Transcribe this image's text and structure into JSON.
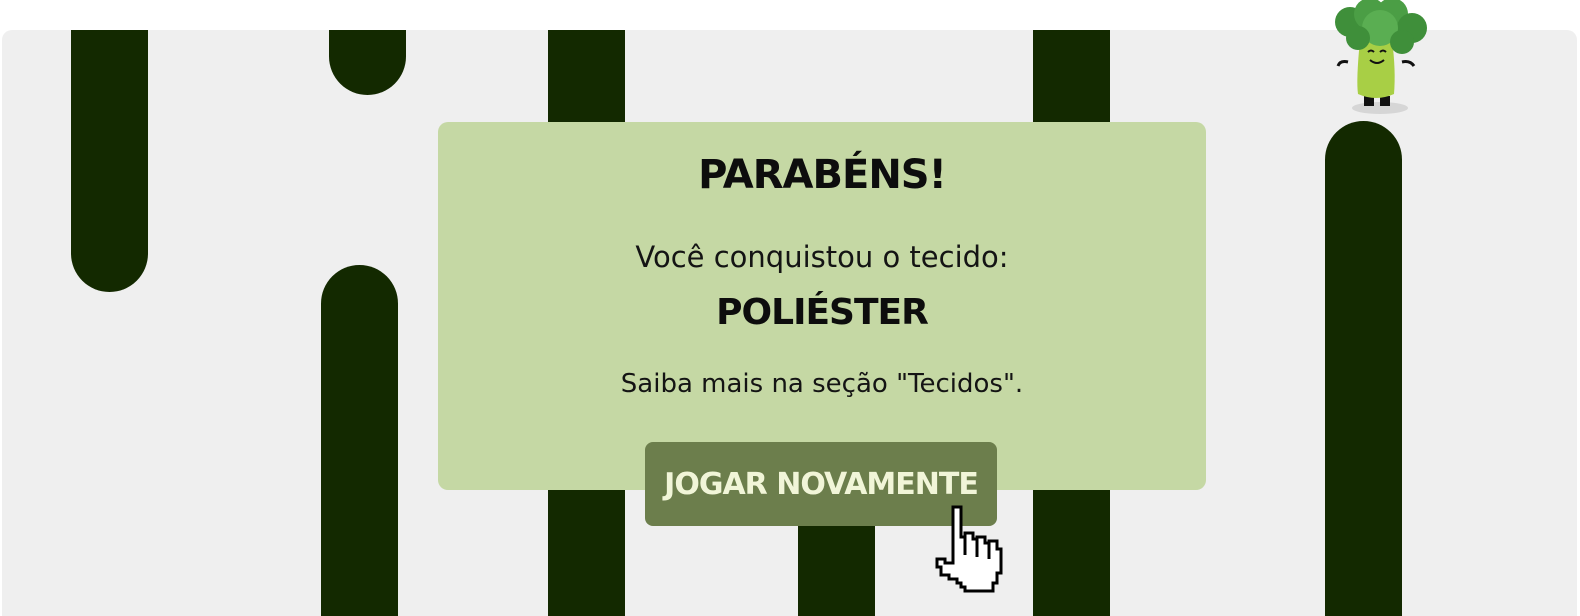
{
  "modal": {
    "title": "PARABÉNS!",
    "subtitle": "Você conquistou o tecido:",
    "fabric_name": "POLIÉSTER",
    "hint": "Saiba mais na seção \"Tecidos\"."
  },
  "actions": {
    "play_again_label": "JOGAR NOVAMENTE"
  },
  "icons": {
    "cursor": "pointer-hand-icon",
    "mascot": "broccoli-mascot-icon"
  },
  "colors": {
    "background": "#efefef",
    "pipe": "#132900",
    "modal": "#c5d8a4",
    "button": "#6c7e4c",
    "button_text": "#f1f5d8"
  }
}
